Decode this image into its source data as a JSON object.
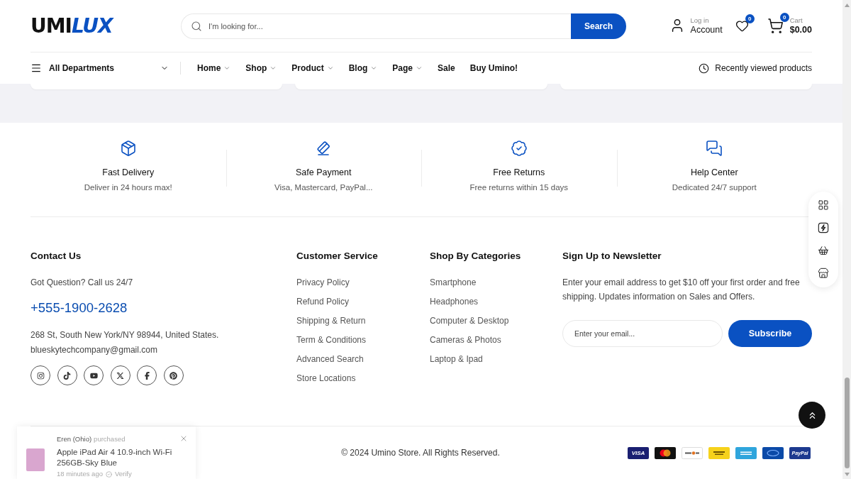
{
  "header": {
    "logo": {
      "dark": "UMI",
      "accent": "LUX"
    },
    "search": {
      "placeholder": "I'm looking for...",
      "button": "Search"
    },
    "account": {
      "caption": "Log in",
      "label": "Account"
    },
    "wishlist": {
      "count": "0"
    },
    "cart": {
      "count": "0",
      "caption": "Cart",
      "total": "$0.00"
    }
  },
  "nav": {
    "departments": "All Departments",
    "items": [
      {
        "label": "Home",
        "dropdown": true
      },
      {
        "label": "Shop",
        "dropdown": true
      },
      {
        "label": "Product",
        "dropdown": true
      },
      {
        "label": "Blog",
        "dropdown": true
      },
      {
        "label": "Page",
        "dropdown": true
      },
      {
        "label": "Sale",
        "dropdown": false
      },
      {
        "label": "Buy Umino!",
        "dropdown": false
      }
    ],
    "recent": "Recently viewed products"
  },
  "features": [
    {
      "kind": "delivery",
      "title": "Fast Delivery",
      "text": "Deliver in 24 hours max!"
    },
    {
      "kind": "payment",
      "title": "Safe Payment",
      "text": "Visa, Mastercard, PayPal..."
    },
    {
      "kind": "returns",
      "title": "Free Returns",
      "text": "Free returns within 15 days"
    },
    {
      "kind": "support",
      "title": "Help Center",
      "text": "Dedicated 24/7 support"
    }
  ],
  "footer": {
    "contact": {
      "title": "Contact Us",
      "question": "Got Question? Call us 24/7",
      "phone": "+555-1900-2628",
      "address": "268 St, South New York/NY 98944, United States.",
      "email": "blueskytechcompany@gmail.com",
      "socials": [
        {
          "kind": "instagram"
        },
        {
          "kind": "tiktok"
        },
        {
          "kind": "youtube"
        },
        {
          "kind": "x"
        },
        {
          "kind": "facebook"
        },
        {
          "kind": "pinterest"
        }
      ]
    },
    "columns": [
      {
        "title": "Customer Service",
        "links": [
          "Privacy Policy",
          "Refund Policy",
          "Shipping & Return",
          "Term & Conditions",
          "Advanced Search",
          "Store Locations"
        ]
      },
      {
        "title": "Shop By Categories",
        "links": [
          "Smartphone",
          "Headphones",
          "Computer & Desktop",
          "Cameras & Photos",
          "Laptop & Ipad"
        ]
      }
    ],
    "newsletter": {
      "title": "Sign Up to Newsletter",
      "text": "Enter your email address to get $10 off your first order and free shipping. Updates information on Sales and Offers.",
      "placeholder": "Enter your email...",
      "button": "Subscribe"
    }
  },
  "bottom_bar": {
    "copyright": "© 2024 Umino Store. All Rights Reserved.",
    "payments": [
      {
        "kind": "visa",
        "label": "VISA"
      },
      {
        "kind": "mastercard"
      },
      {
        "kind": "discover"
      },
      {
        "kind": "yellow"
      },
      {
        "kind": "amex"
      },
      {
        "kind": "cirrus"
      },
      {
        "kind": "paypal",
        "label": "PayPal"
      }
    ]
  },
  "side_toolbar": [
    {
      "kind": "grid"
    },
    {
      "kind": "flash"
    },
    {
      "kind": "basket"
    },
    {
      "kind": "store"
    }
  ],
  "purchase_popup": {
    "buyer": "Eren (Ohio)",
    "action": "purchased",
    "product": "Apple iPad Air 4 10.9-inch Wi-Fi 256GB-Sky Blue",
    "time": "18 minutes ago",
    "verify": "Verify"
  }
}
